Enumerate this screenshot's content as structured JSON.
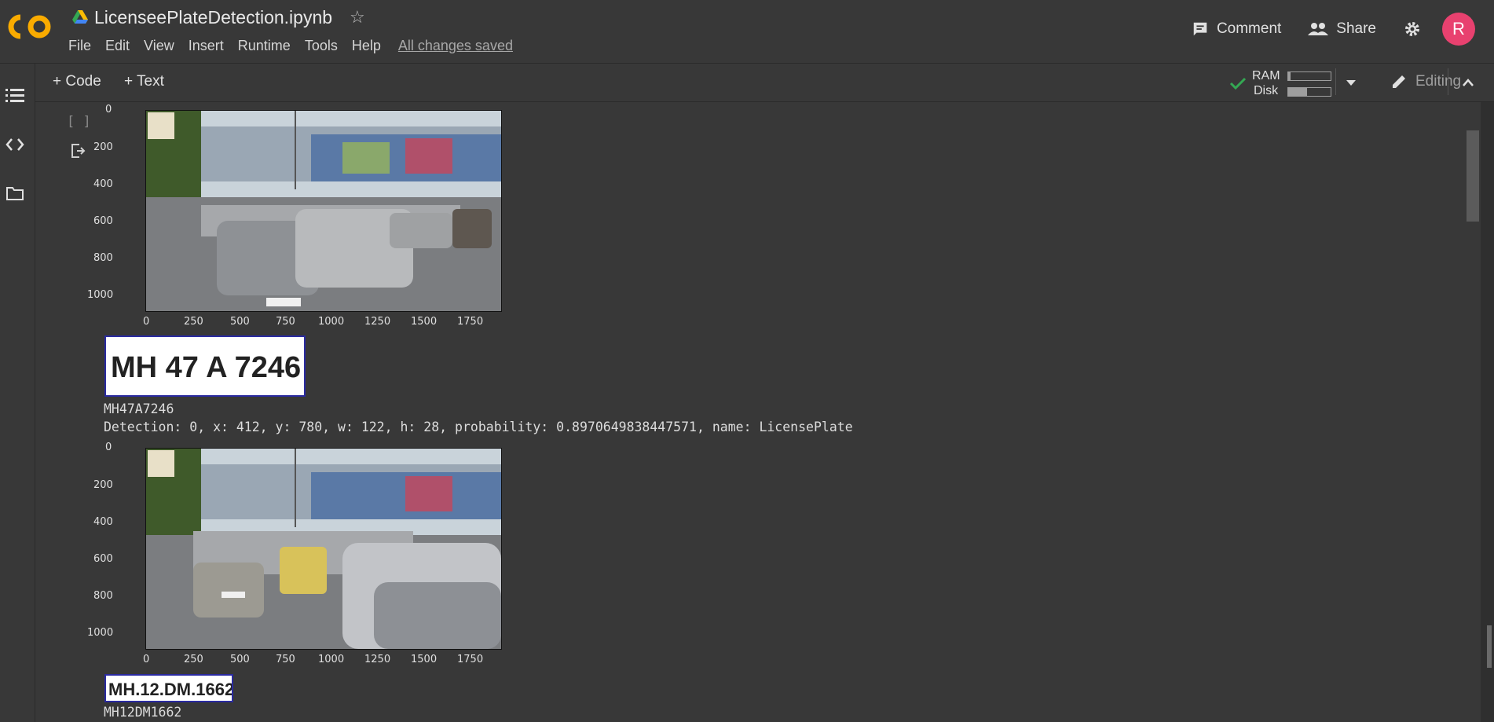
{
  "header": {
    "app_logo": "CO",
    "notebook_title": "LicenseePlateDetection.ipynb",
    "menu": [
      "File",
      "Edit",
      "View",
      "Insert",
      "Runtime",
      "Tools",
      "Help"
    ],
    "save_status": "All changes saved",
    "comment_label": "Comment",
    "share_label": "Share",
    "avatar_letter": "R"
  },
  "toolbar": {
    "code_label": "+ Code",
    "text_label": "+ Text",
    "ram_label": "RAM",
    "disk_label": "Disk",
    "ram_fraction": 0.05,
    "disk_fraction": 0.45,
    "mode_label": "Editing"
  },
  "cell": {
    "run_bracket": "[ ]",
    "outputs": [
      {
        "y_ticks": [
          "0",
          "200",
          "400",
          "600",
          "800",
          "1000"
        ],
        "x_ticks": [
          "0",
          "250",
          "500",
          "750",
          "1000",
          "1250",
          "1500",
          "1750"
        ],
        "plate_text": "MH 47 A  7246",
        "ocr_text": "MH47A7246",
        "detection": "Detection: 0, x: 412, y: 780, w: 122, h: 28, probability: 0.8970649838447571, name: LicensePlate"
      },
      {
        "y_ticks": [
          "0",
          "200",
          "400",
          "600",
          "800",
          "1000"
        ],
        "x_ticks": [
          "0",
          "250",
          "500",
          "750",
          "1000",
          "1250",
          "1500",
          "1750"
        ],
        "plate_text": "MH.12.DM.1662",
        "ocr_text": "MH12DM1662"
      }
    ]
  },
  "colors": {
    "background": "#383838",
    "avatar": "#e8416f",
    "check": "#34a853",
    "logo_orange": "#f9ab00"
  }
}
